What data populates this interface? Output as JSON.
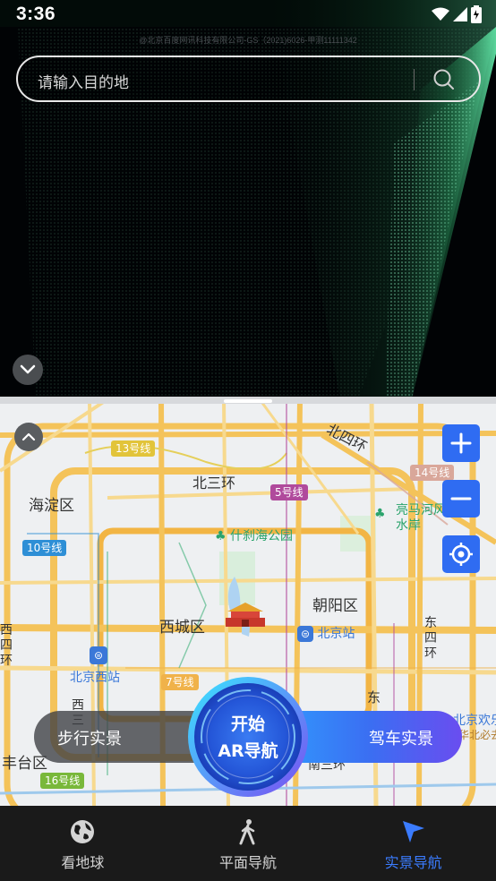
{
  "status_bar": {
    "time": "3:36"
  },
  "copyright": "@北京百度网讯科技有限公司-GS（2021)6026-甲测11111342",
  "search": {
    "placeholder": "请输入目的地"
  },
  "map": {
    "districts": [
      "海淀区",
      "西城区",
      "朝阳区",
      "丰台区"
    ],
    "roads": [
      "北三环",
      "北四环"
    ],
    "partial_labels": [
      "西四环",
      "东四环",
      "西三",
      "东",
      "南三环",
      "北京欢乐",
      "华北必去"
    ],
    "pois": [
      "什刹海公园",
      "亮马河风情水岸"
    ],
    "stations": [
      "北京站",
      "北京西站"
    ],
    "metro_lines": [
      {
        "label": "13号线",
        "color": "#e2c43a"
      },
      {
        "label": "5号线",
        "color": "#b04a9c"
      },
      {
        "label": "14号线",
        "color": "#d9a79a"
      },
      {
        "label": "10号线",
        "color": "#2e8fd6"
      },
      {
        "label": "7号线",
        "color": "#f0b24a"
      },
      {
        "label": "16号线",
        "color": "#79b83a"
      }
    ]
  },
  "controls": {
    "zoom_in": "+",
    "zoom_out": "−"
  },
  "ar_nav": {
    "walk_label": "步行实景",
    "drive_label": "驾车实景",
    "start_line1": "开始",
    "start_line2": "AR导航"
  },
  "tabs": [
    {
      "label": "看地球",
      "icon": "globe-icon",
      "active": false
    },
    {
      "label": "平面导航",
      "icon": "walking-person-icon",
      "active": false
    },
    {
      "label": "实景导航",
      "icon": "navigation-arrow-icon",
      "active": true
    }
  ],
  "colors": {
    "accent": "#3b7cff",
    "map_button": "#2f6cf2",
    "tab_bar": "#1a1a1a"
  }
}
